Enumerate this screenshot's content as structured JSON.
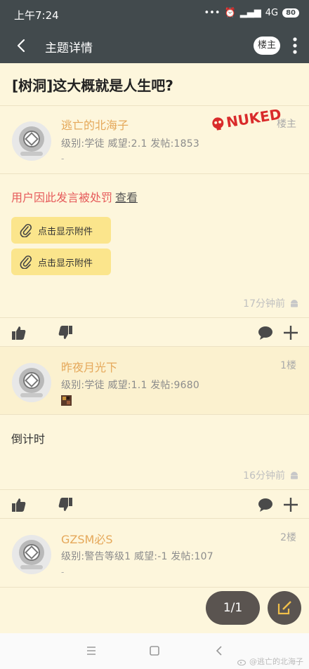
{
  "status_bar": {
    "time": "上午7:24",
    "network": "4G",
    "battery": "80"
  },
  "app_bar": {
    "title": "主题详情",
    "owner_button": "楼主"
  },
  "thread": {
    "title": "[树洞]这大概就是人生吧?"
  },
  "posts": [
    {
      "username": "逃亡的北海子",
      "floor": "楼主",
      "meta": "级别:学徒   威望:2.1   发帖:1853",
      "signature": "-",
      "stamp": "NUKED",
      "warning": "用户因此发言被处罚",
      "warning_link": "查看",
      "attachments": [
        "点击显示附件",
        "点击显示附件"
      ],
      "time": "17分钟前"
    },
    {
      "username": "昨夜月光下",
      "floor": "1楼",
      "meta": "级别:学徒   威望:1.1   发帖:9680",
      "content": "倒计时",
      "time": "16分钟前"
    },
    {
      "username": "GZSM必S",
      "floor": "2楼",
      "meta": "级别:警告等级1   威望:-1   发帖:107",
      "signature": "-"
    }
  ],
  "pagination": {
    "label": "1/1"
  },
  "watermark": "@逃亡的北海子",
  "colors": {
    "app_bar": "#424a4d",
    "background": "#fdf6dc",
    "username": "#e5a85a",
    "attachment": "#fbe58c",
    "warning": "#e65a5a",
    "nuked": "#d92b2b"
  }
}
